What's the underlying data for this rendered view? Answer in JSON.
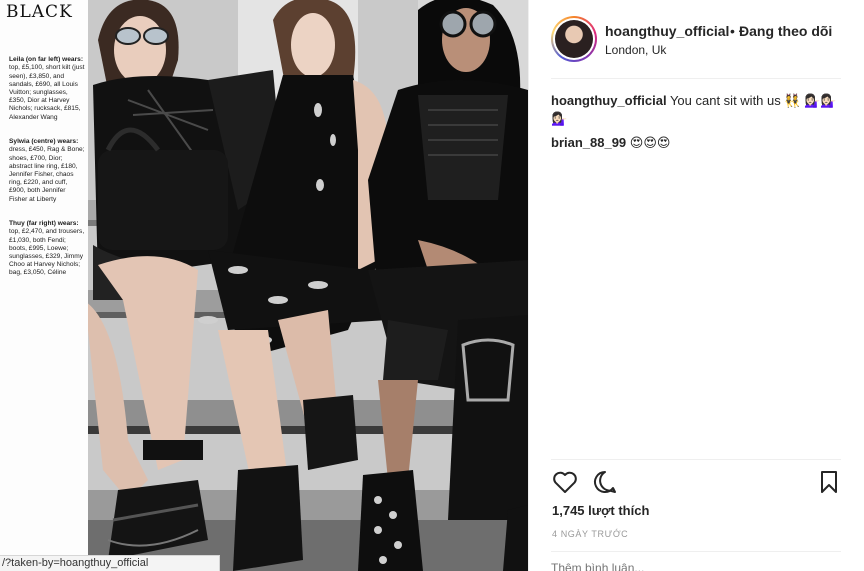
{
  "photo": {
    "magazine_heading": "BLACK",
    "magazine_credits": [
      {
        "bold": "Leila (on far left) wears:",
        "text": " top, £5,100, short kilt (just seen), £3,850, and sandals, £690, all Louis Vuitton; sunglasses, £350, Dior at Harvey Nichols; rucksack, £815, Alexander Wang"
      },
      {
        "bold": "Sylwia (centre) wears:",
        "text": " dress, £450, Rag & Bone; shoes, £700, Dior; abstract line ring, £180, Jennifer Fisher, chaos ring, £220, and cuff, £900, both Jennifer Fisher at Liberty"
      },
      {
        "bold": "Thuy (far right) wears:",
        "text": " top, £2,470, and trousers, £1,030, both Fendi; boots, £995, Loewe; sunglasses, £329, Jimmy Choo at Harvey Nichols; bag, £3,050, Céline"
      }
    ]
  },
  "post": {
    "username": "hoangthuy_official",
    "separator": "•",
    "follow_status": "Đang theo dõi",
    "location": "London, Uk",
    "comments": [
      {
        "author": "hoangthuy_official",
        "text": "You cant sit with us 👯 💁🏻‍♀️💁🏻‍♀️💁🏻‍♀️"
      },
      {
        "author": "brian_88_99",
        "text": "😍😍😍"
      }
    ],
    "likes": "1,745 lượt thích",
    "time": "4 NGÀY TRƯỚC",
    "comment_placeholder": "Thêm bình luận..."
  },
  "icons": {
    "like": "heart-icon",
    "comment": "comment-bubble-icon",
    "save": "bookmark-icon"
  },
  "statusbar": {
    "url": "/?taken-by=hoangthuy_official"
  },
  "colors": {
    "text": "#262626",
    "muted": "#999999",
    "divider": "#efefef",
    "avatar_ring": [
      "#f58529",
      "#dd2a7b",
      "#8134af",
      "#515bd4"
    ]
  }
}
